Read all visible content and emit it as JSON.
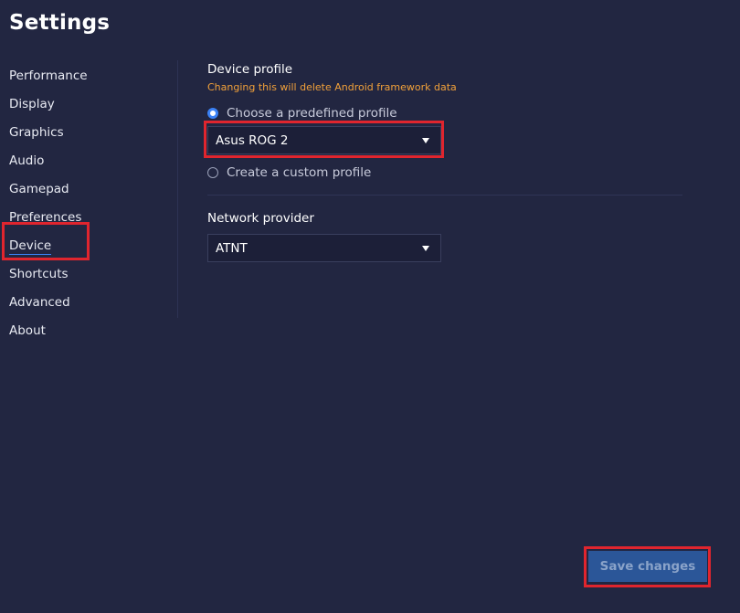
{
  "title": "Settings",
  "sidebar": {
    "items": [
      {
        "label": "Performance"
      },
      {
        "label": "Display"
      },
      {
        "label": "Graphics"
      },
      {
        "label": "Audio"
      },
      {
        "label": "Gamepad"
      },
      {
        "label": "Preferences"
      },
      {
        "label": "Device",
        "active": true
      },
      {
        "label": "Shortcuts"
      },
      {
        "label": "Advanced"
      },
      {
        "label": "About"
      }
    ]
  },
  "device_profile": {
    "title": "Device profile",
    "warning": "Changing this will delete Android framework data",
    "option_predefined": "Choose a predefined profile",
    "option_custom": "Create a custom profile",
    "selected_option": "predefined",
    "selected_profile": "Asus ROG 2"
  },
  "network": {
    "title": "Network provider",
    "selected": "ATNT"
  },
  "save_label": "Save changes",
  "colors": {
    "background": "#222641",
    "accent": "#3b82f6",
    "warning": "#f2a13a",
    "highlight": "#e0252e",
    "button": "#2b5698"
  },
  "icons": {
    "dropdown": "chevron-down-icon",
    "radio_checked": "radio-checked-icon",
    "radio_unchecked": "radio-unchecked-icon"
  }
}
